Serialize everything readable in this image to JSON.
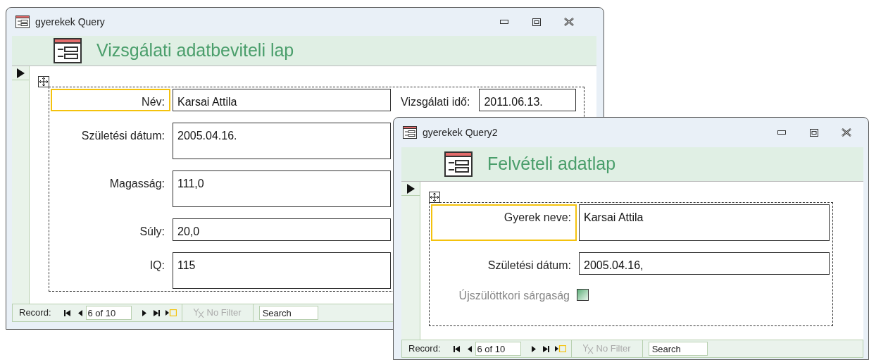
{
  "windows": [
    {
      "title": "gyerekek Query",
      "heading": "Vizsgálati adatbeviteli lap",
      "rows": [
        [
          {
            "kind": "single",
            "label": "Név:",
            "value": "Karsai Attila",
            "selected": true
          },
          {
            "kind": "single",
            "label": "Vizsgálati idő:",
            "value": "2011.06.13.",
            "selected": false
          }
        ],
        [
          {
            "kind": "multi",
            "label": "Születési dátum:",
            "value": "2005.04.16.",
            "selected": false
          }
        ],
        [
          {
            "kind": "multi",
            "label": "Magasság:",
            "value": "111,0",
            "selected": false
          }
        ],
        [
          {
            "kind": "single",
            "label": "Súly:",
            "value": "20,0",
            "selected": false
          }
        ],
        [
          {
            "kind": "multi",
            "label": "IQ:",
            "value": "115",
            "selected": false
          }
        ]
      ],
      "nav": {
        "label": "Record:",
        "position": "6 of 10",
        "filter": "No Filter",
        "search_placeholder": "Search"
      }
    },
    {
      "title": "gyerekek Query2",
      "heading": "Felvételi adatlap",
      "rows": [
        [
          {
            "kind": "multi",
            "label": "Gyerek neve:",
            "value": "Karsai Attila",
            "selected": true
          }
        ],
        [
          {
            "kind": "single",
            "label": "Születési dátum:",
            "value": "2005.04.16,",
            "selected": false
          }
        ],
        [
          {
            "kind": "checkbox",
            "label": "Újszülöttkori sárgaság",
            "checked": false,
            "disabled": true
          }
        ]
      ],
      "nav": {
        "label": "Record:",
        "position": "6 of 10",
        "filter": "No Filter",
        "search_placeholder": "Search"
      }
    }
  ]
}
